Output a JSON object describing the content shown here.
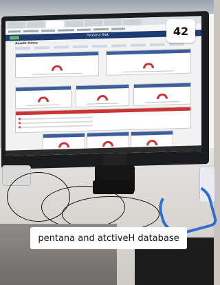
{
  "badge": {
    "number": "42"
  },
  "screen": {
    "brand": "Pentana Risk",
    "page_title": "Assets Home",
    "panels": [
      {
        "row": 1,
        "count": 2
      },
      {
        "row": 2,
        "count": 3
      },
      {
        "row": 4,
        "count": 3
      }
    ],
    "exceptions_panel": {
      "rows": 3
    }
  },
  "caption": {
    "text": "pentana and atctiveH database"
  },
  "colors": {
    "app_bar": "#1f3b73",
    "gauge": "#cc3333",
    "exceptions_header": "#c33"
  }
}
